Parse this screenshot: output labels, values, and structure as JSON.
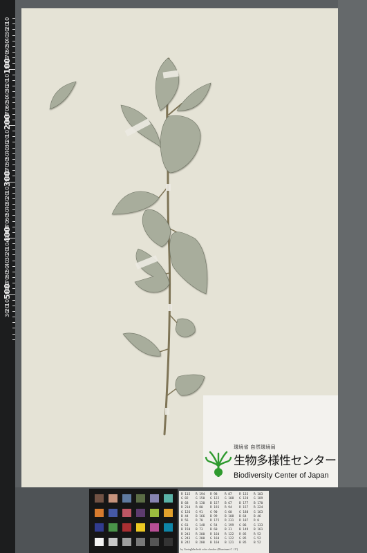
{
  "ruler": {
    "major_labels": [
      "100",
      "200",
      "300",
      "400",
      "500"
    ],
    "minor_labels": [
      "10",
      "20",
      "30",
      "40",
      "50",
      "60",
      "70",
      "80",
      "90",
      "10",
      "20",
      "30",
      "40",
      "50",
      "60",
      "70",
      "80",
      "90",
      "10",
      "20",
      "30",
      "40",
      "50",
      "60",
      "70",
      "80",
      "90",
      "10",
      "20",
      "30",
      "40",
      "50",
      "60",
      "70",
      "80",
      "90",
      "10",
      "20",
      "30",
      "40",
      "50",
      "60",
      "70",
      "80",
      "90",
      "10",
      "20",
      "30"
    ]
  },
  "institution": {
    "ministry": "環境省 自然環境局",
    "name_jp": "生物多様性センター",
    "name_en": "Biodiversity Center of Japan"
  },
  "color_checker": {
    "patches": [
      "#715244",
      "#c6937d",
      "#5f7aa0",
      "#5b6c45",
      "#8784b2",
      "#5ab2a7",
      "#d77b2e",
      "#4558a5",
      "#be5664",
      "#5d3b6e",
      "#9cbb3f",
      "#e2a12c",
      "#313c8f",
      "#4a9449",
      "#aa2f32",
      "#ecc822",
      "#b84e95",
      "#0e85a7",
      "#f3f3f2",
      "#c8c8c8",
      "#a0a0a0",
      "#797979",
      "#555555",
      "#343434"
    ],
    "footer": "by  GretagMacbeth color checker  (Illuminant C / 2°)"
  },
  "values_table": [
    [
      "R 115",
      "R 194",
      "R 98",
      "R 87",
      "R 133",
      "R 103"
    ],
    [
      "G 82",
      "G 150",
      "G 122",
      "G 108",
      "G 128",
      "G 189"
    ],
    [
      "B 68",
      "B 130",
      "B 157",
      "B 67",
      "B 177",
      "B 170"
    ],
    [
      "R 214",
      "R 80",
      "R 193",
      "R 94",
      "R 157",
      "R 224"
    ],
    [
      "G 126",
      "G 91",
      "G 90",
      "G 60",
      "G 188",
      "G 163"
    ],
    [
      "B 44",
      "B 166",
      "B 99",
      "B 108",
      "B 64",
      "B 46"
    ],
    [
      "R 56",
      "R 70",
      "R 175",
      "R 231",
      "R 187",
      "R 8"
    ],
    [
      "G 61",
      "G 148",
      "G 54",
      "G 199",
      "G 86",
      "G 133"
    ],
    [
      "B 150",
      "B 73",
      "B 60",
      "B 31",
      "B 149",
      "B 161"
    ],
    [
      "R 243",
      "R 200",
      "R 160",
      "R 122",
      "R 85",
      "R 52"
    ],
    [
      "G 243",
      "G 200",
      "G 160",
      "G 122",
      "G 85",
      "G 52"
    ],
    [
      "B 242",
      "B 200",
      "B 160",
      "B 121",
      "B 85",
      "B 52"
    ]
  ],
  "colors": {
    "sheet": "#e5e3d6",
    "leaf": "#a8ad9c",
    "stem": "#7e7456"
  }
}
